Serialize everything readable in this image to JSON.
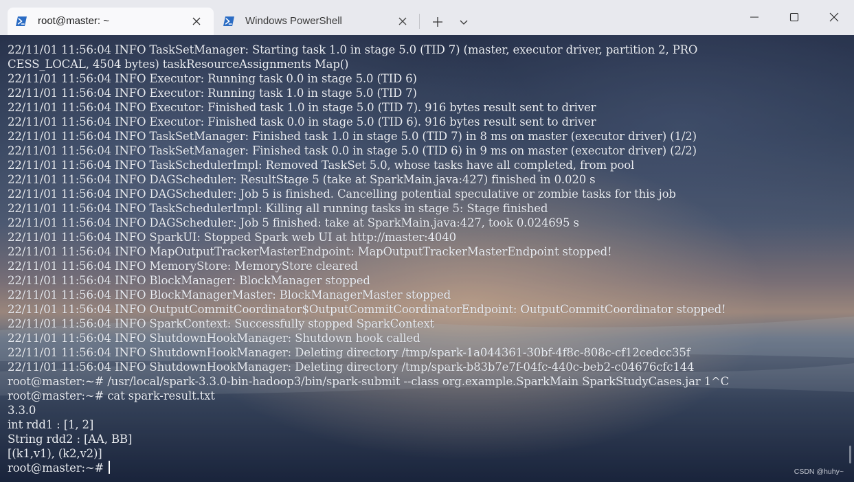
{
  "tabs": [
    {
      "label": "root@master: ~",
      "icon": "powershell-icon",
      "active": true
    },
    {
      "label": "Windows PowerShell",
      "icon": "powershell-icon",
      "active": false
    }
  ],
  "window_controls": [
    "minimize-icon",
    "maximize-icon",
    "close-icon"
  ],
  "colors": {
    "titlebar": "#e8e9ee",
    "active_tab": "#f9f9fb",
    "powershell_blue": "#2b6cc4",
    "terminal_text": "#e9ecf2"
  },
  "terminal": {
    "lines": [
      "22/11/01 11:56:04 INFO TaskSetManager: Starting task 1.0 in stage 5.0 (TID 7) (master, executor driver, partition 2, PRO",
      "CESS_LOCAL, 4504 bytes) taskResourceAssignments Map()",
      "22/11/01 11:56:04 INFO Executor: Running task 0.0 in stage 5.0 (TID 6)",
      "22/11/01 11:56:04 INFO Executor: Running task 1.0 in stage 5.0 (TID 7)",
      "22/11/01 11:56:04 INFO Executor: Finished task 1.0 in stage 5.0 (TID 7). 916 bytes result sent to driver",
      "22/11/01 11:56:04 INFO Executor: Finished task 0.0 in stage 5.0 (TID 6). 916 bytes result sent to driver",
      "22/11/01 11:56:04 INFO TaskSetManager: Finished task 1.0 in stage 5.0 (TID 7) in 8 ms on master (executor driver) (1/2)",
      "22/11/01 11:56:04 INFO TaskSetManager: Finished task 0.0 in stage 5.0 (TID 6) in 9 ms on master (executor driver) (2/2)",
      "22/11/01 11:56:04 INFO TaskSchedulerImpl: Removed TaskSet 5.0, whose tasks have all completed, from pool",
      "22/11/01 11:56:04 INFO DAGScheduler: ResultStage 5 (take at SparkMain.java:427) finished in 0.020 s",
      "22/11/01 11:56:04 INFO DAGScheduler: Job 5 is finished. Cancelling potential speculative or zombie tasks for this job",
      "22/11/01 11:56:04 INFO TaskSchedulerImpl: Killing all running tasks in stage 5: Stage finished",
      "22/11/01 11:56:04 INFO DAGScheduler: Job 5 finished: take at SparkMain.java:427, took 0.024695 s",
      "22/11/01 11:56:04 INFO SparkUI: Stopped Spark web UI at http://master:4040",
      "22/11/01 11:56:04 INFO MapOutputTrackerMasterEndpoint: MapOutputTrackerMasterEndpoint stopped!",
      "22/11/01 11:56:04 INFO MemoryStore: MemoryStore cleared",
      "22/11/01 11:56:04 INFO BlockManager: BlockManager stopped",
      "22/11/01 11:56:04 INFO BlockManagerMaster: BlockManagerMaster stopped",
      "22/11/01 11:56:04 INFO OutputCommitCoordinator$OutputCommitCoordinatorEndpoint: OutputCommitCoordinator stopped!",
      "22/11/01 11:56:04 INFO SparkContext: Successfully stopped SparkContext",
      "22/11/01 11:56:04 INFO ShutdownHookManager: Shutdown hook called",
      "22/11/01 11:56:04 INFO ShutdownHookManager: Deleting directory /tmp/spark-1a044361-30bf-4f8c-808c-cf12cedcc35f",
      "22/11/01 11:56:04 INFO ShutdownHookManager: Deleting directory /tmp/spark-b83b7e7f-04fc-440c-beb2-c04676cfc144",
      "root@master:~# /usr/local/spark-3.3.0-bin-hadoop3/bin/spark-submit --class org.example.SparkMain SparkStudyCases.jar 1^C",
      "root@master:~# cat spark-result.txt",
      "3.3.0",
      "int rdd1 : [1, 2]",
      "String rdd2 : [AA, BB]",
      "[(k1,v1), (k2,v2)]"
    ],
    "prompt": "root@master:~# ",
    "watermark": "CSDN @huhy~"
  }
}
